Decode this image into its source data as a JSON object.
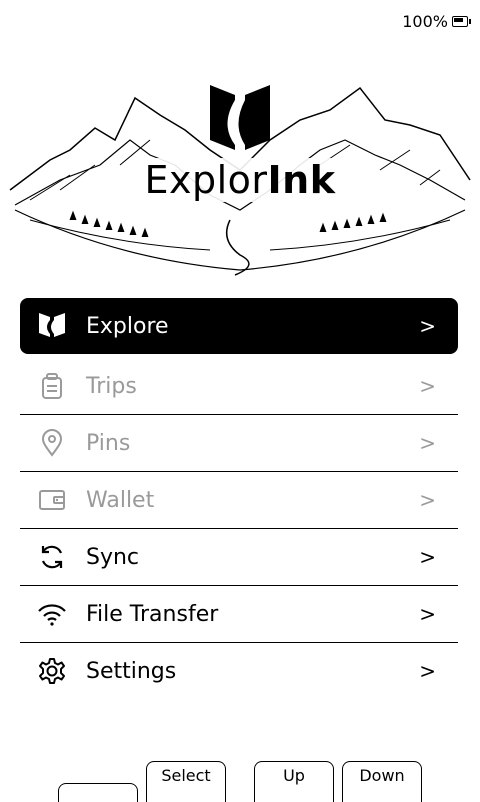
{
  "status": {
    "battery_text": "100%",
    "battery_icon": "battery-charging-icon"
  },
  "brand": {
    "name_light": "Explor",
    "name_bold": "Ink"
  },
  "menu": {
    "items": [
      {
        "label": "Explore",
        "icon": "explorink-logo-icon",
        "state": "selected"
      },
      {
        "label": "Trips",
        "icon": "backpack-icon",
        "state": "disabled"
      },
      {
        "label": "Pins",
        "icon": "location-pin-icon",
        "state": "disabled"
      },
      {
        "label": "Wallet",
        "icon": "wallet-icon",
        "state": "disabled"
      },
      {
        "label": "Sync",
        "icon": "sync-icon",
        "state": "enabled"
      },
      {
        "label": "File Transfer",
        "icon": "wifi-icon",
        "state": "enabled"
      },
      {
        "label": "Settings",
        "icon": "gear-icon",
        "state": "enabled"
      }
    ],
    "chevron": ">"
  },
  "softkeys": {
    "blank": "",
    "select": "Select",
    "up": "Up",
    "down": "Down"
  }
}
